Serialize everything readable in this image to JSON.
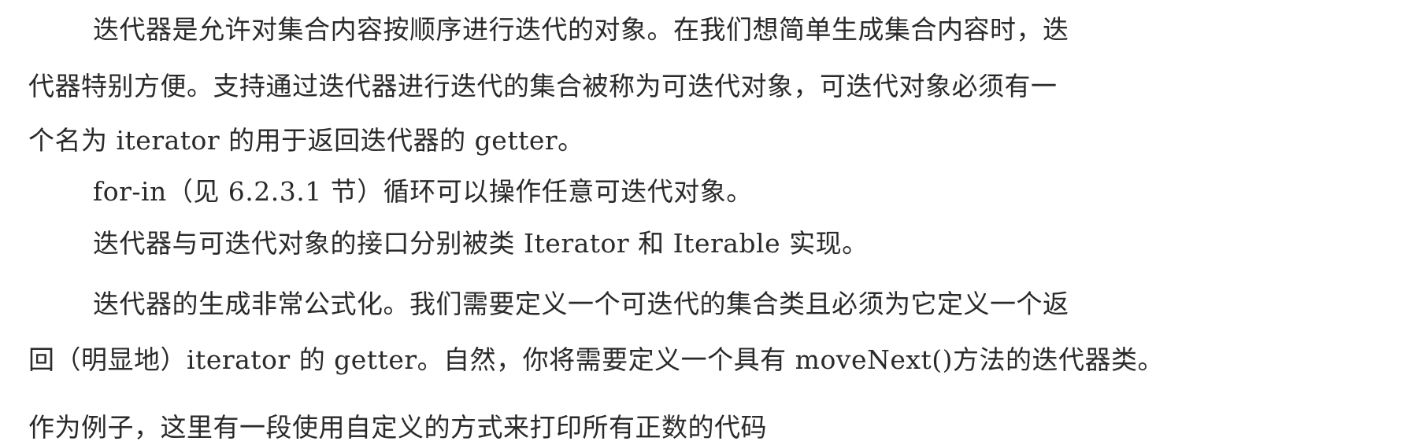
{
  "paragraphs": [
    {
      "lines": [
        "迭代器是允许对集合内容按顺序进行迭代的对象。在我们想简单生成集合内容时，迭",
        "代器特别方便。支持通过迭代器进行迭代的集合被称为可迭代对象，可迭代对象必须有一",
        "个名为 iterator 的用于返回迭代器的 getter。"
      ]
    },
    {
      "lines": [
        "for-in（见 6.2.3.1 节）循环可以操作任意可迭代对象。"
      ]
    },
    {
      "lines": [
        "迭代器与可迭代对象的接口分别被类 Iterator 和 Iterable 实现。"
      ]
    },
    {
      "lines": [
        "迭代器的生成非常公式化。我们需要定义一个可迭代的集合类且必须为它定义一个返",
        "回（明显地）iterator 的 getter。自然，你将需要定义一个具有 moveNext()方法的迭代器类。",
        "作为例子，这里有一段使用自定义的方式来打印所有正数的代码"
      ]
    }
  ]
}
